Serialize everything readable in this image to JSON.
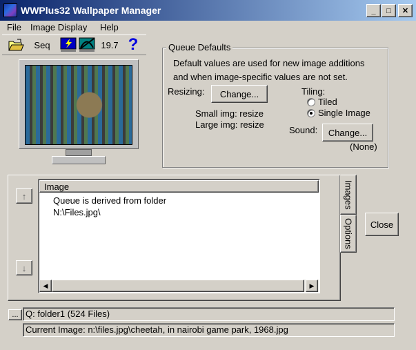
{
  "window": {
    "title": "WWPlus32 Wallpaper Manager",
    "minimize_glyph": "_",
    "maximize_glyph": "□",
    "close_glyph": "✕"
  },
  "menu": [
    {
      "label": "File"
    },
    {
      "label": "Image Display"
    },
    {
      "label": "Help"
    }
  ],
  "toolbar": {
    "seq_label": "Seq",
    "interval": "19.7",
    "help_glyph": "?"
  },
  "queue_defaults": {
    "legend": "Queue Defaults",
    "description_line1": "Default values are used for new image additions",
    "description_line2": "and when image-specific values are not set.",
    "resizing_label": "Resizing:",
    "resizing_button": "Change...",
    "small_img": "Small img: resize",
    "large_img": "Large img: resize",
    "tiling_label": "Tiling:",
    "tiling_options": [
      {
        "label": "Tiled",
        "selected": false
      },
      {
        "label": "Single Image",
        "selected": true
      }
    ],
    "sound_label": "Sound:",
    "sound_button": "Change...",
    "sound_value": "(None)"
  },
  "image_list": {
    "header": "Image",
    "rows": [
      "Queue is derived from folder",
      "N:\\Files.jpg\\"
    ],
    "up_arrow": "↑",
    "down_arrow": "↓"
  },
  "tabs": [
    {
      "label": "Images",
      "active": true
    },
    {
      "label": "Options",
      "active": false
    }
  ],
  "close_button": "Close",
  "status": {
    "more_button": "...",
    "queue": "Q: folder1 (524 Files)",
    "current_image": "Current Image: n:\\files.jpg\\cheetah, in nairobi game park, 1968.jpg"
  }
}
